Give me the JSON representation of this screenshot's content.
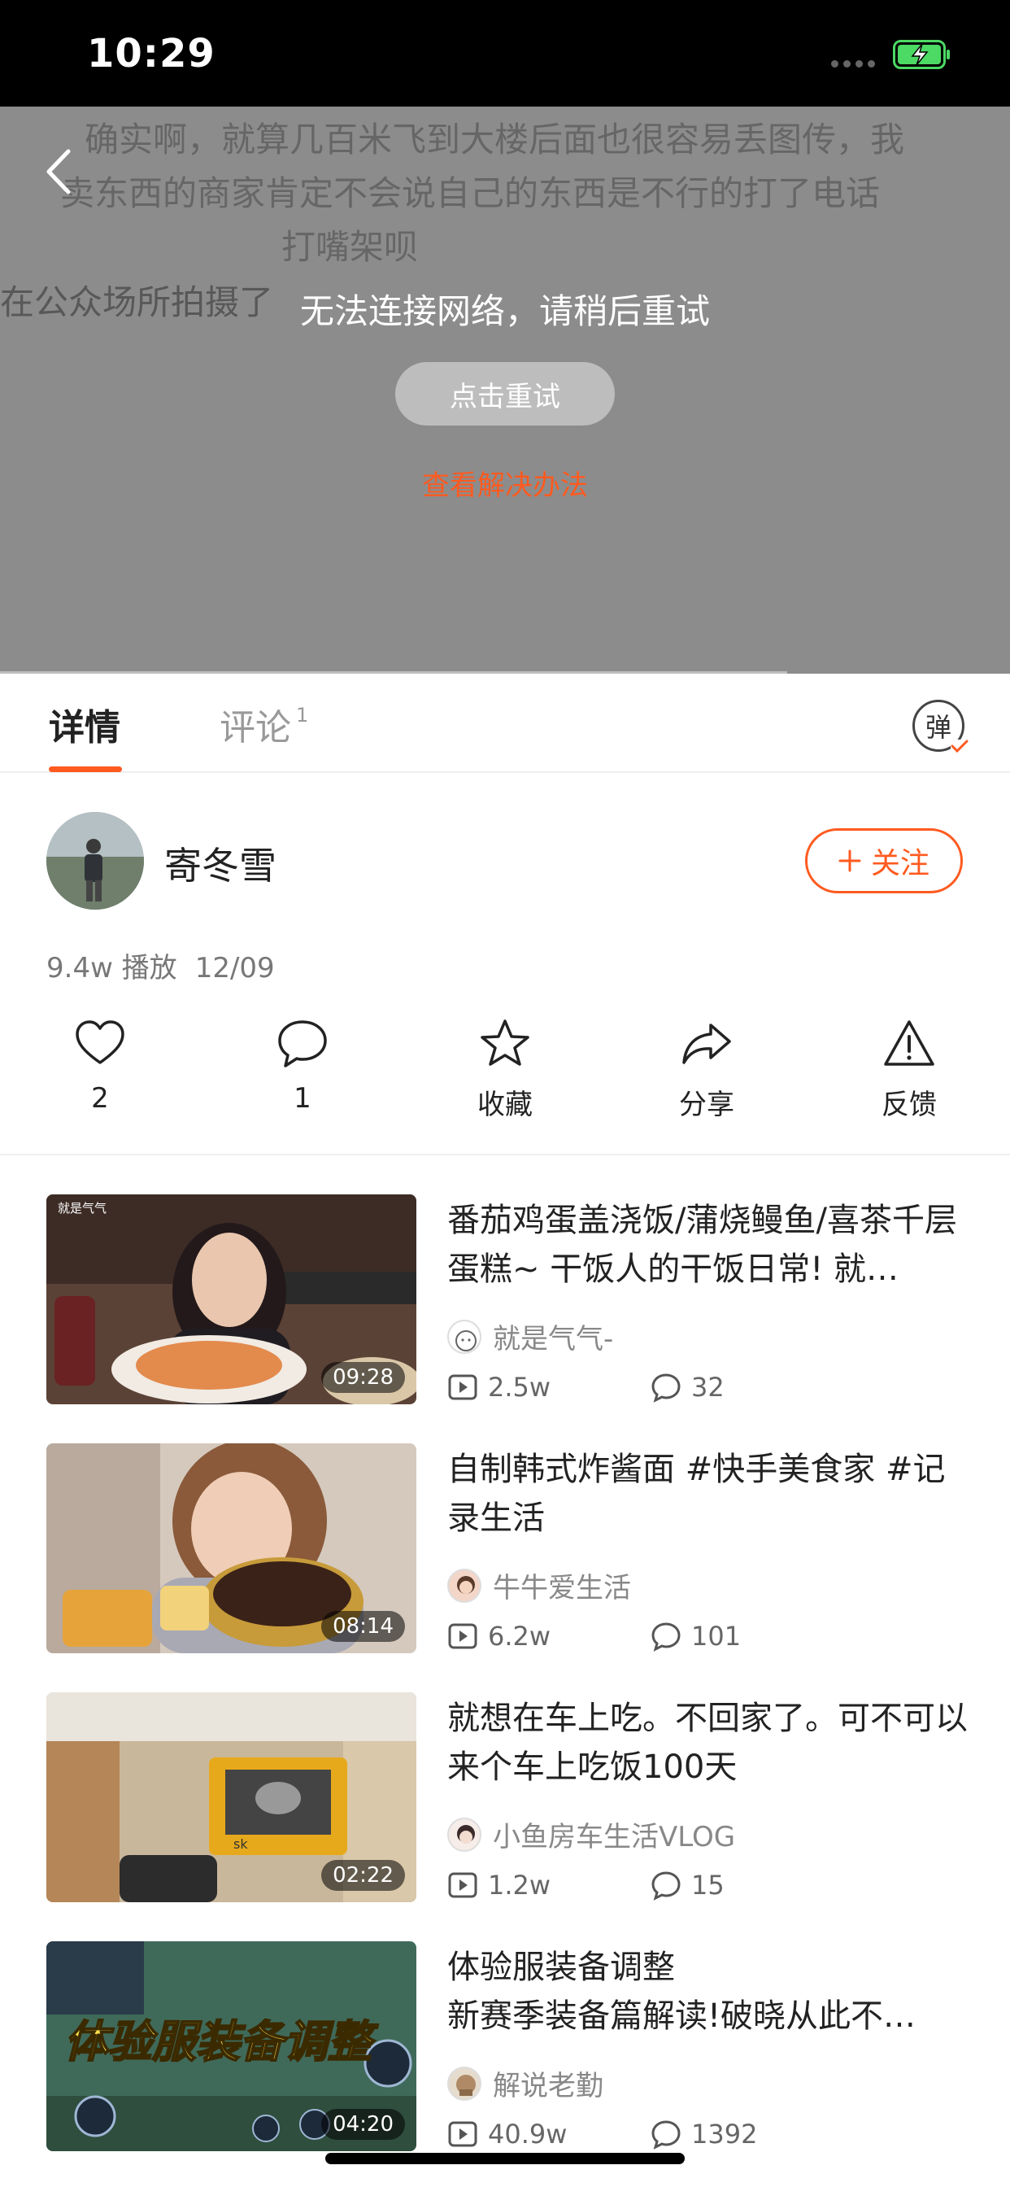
{
  "status_bar": {
    "time": "10:29"
  },
  "player": {
    "danmaku": [
      "确实啊，就算几百米飞到大楼后面也很容易丢图传，我",
      "卖东西的商家肯定不会说自己的东西是不行的打了电话",
      "打嘴架呗",
      "在公众场所拍摄了"
    ],
    "error_message": "无法连接网络，请稍后重试",
    "retry_label": "点击重试",
    "solution_link": "查看解决办法"
  },
  "tabs": {
    "details": "详情",
    "comments": "评论",
    "comments_count": "1",
    "danmu_toggle": "弹"
  },
  "author": {
    "name": "寄冬雪",
    "follow_label": "关注",
    "plays": "9.4w 播放",
    "date": "12/09"
  },
  "actions": {
    "like": "2",
    "comment": "1",
    "favorite": "收藏",
    "share": "分享",
    "feedback": "反馈"
  },
  "related": [
    {
      "title": "番茄鸡蛋盖浇饭/蒲烧鳗鱼/喜茶千层蛋糕~ 干饭人的干饭日常! 就…",
      "author": "就是气气-",
      "plays": "2.5w",
      "comments": "32",
      "duration": "09:28",
      "thumb_label": "就是气气"
    },
    {
      "title": "自制韩式炸酱面  #快手美食家 #记录生活",
      "author": "牛牛爱生活",
      "plays": "6.2w",
      "comments": "101",
      "duration": "08:14"
    },
    {
      "title": "就想在车上吃。不回家了。可不可以来个车上吃饭100天",
      "author": "小鱼房车生活VLOG",
      "plays": "1.2w",
      "comments": "15",
      "duration": "02:22"
    },
    {
      "title": "体验服装备调整\n新赛季装备篇解读!破晓从此不…",
      "author": "解说老勤",
      "plays": "40.9w",
      "comments": "1392",
      "duration": "04:20",
      "thumb_text": "体验服装备调整"
    }
  ],
  "colors": {
    "accent": "#ff5a1f",
    "video_bg": "#8c8c8c"
  }
}
